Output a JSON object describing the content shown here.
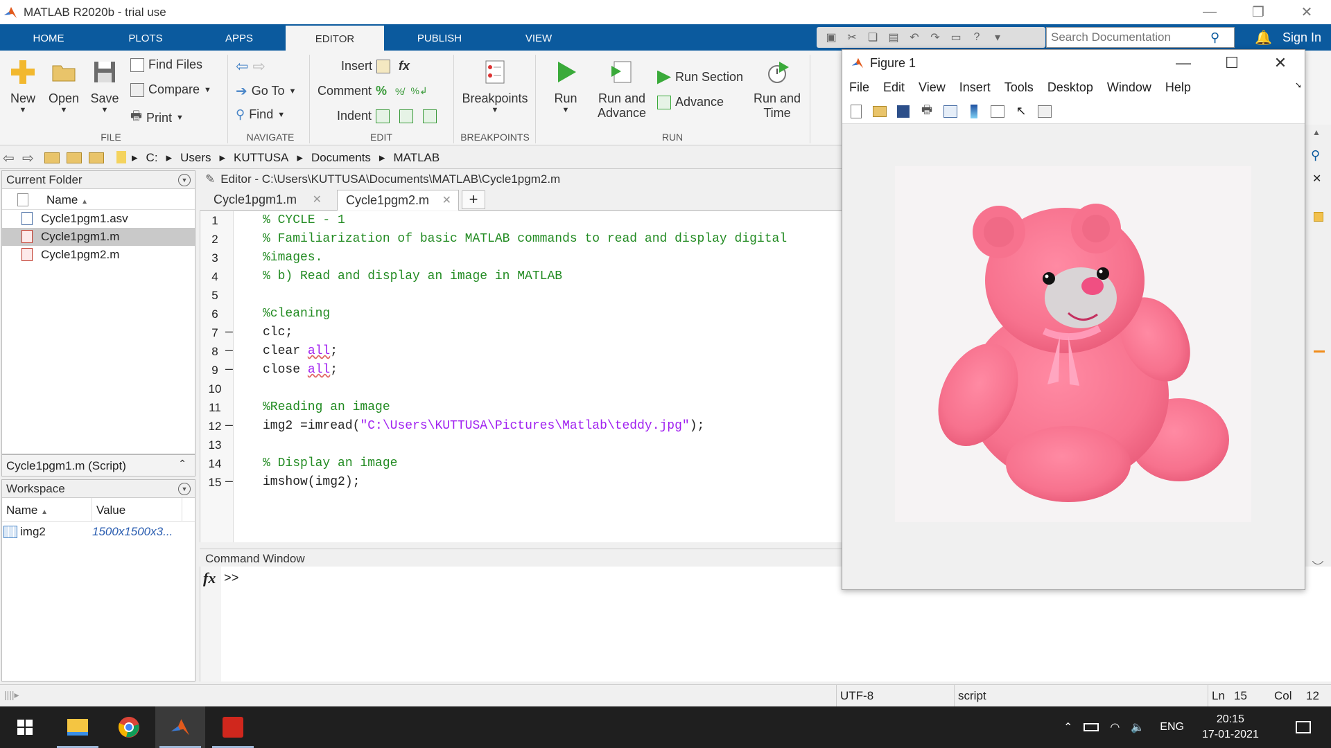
{
  "window": {
    "title": "MATLAB R2020b - trial use"
  },
  "tabs": [
    {
      "label": "HOME"
    },
    {
      "label": "PLOTS"
    },
    {
      "label": "APPS"
    },
    {
      "label": "EDITOR"
    },
    {
      "label": "PUBLISH"
    },
    {
      "label": "VIEW"
    }
  ],
  "search": {
    "placeholder": "Search Documentation"
  },
  "signin": "Sign In",
  "ribbon": {
    "file": {
      "new": "New",
      "open": "Open",
      "save": "Save",
      "find_files": "Find Files",
      "compare": "Compare",
      "print": "Print",
      "group": "FILE"
    },
    "navigate": {
      "goto": "Go To",
      "find": "Find",
      "group": "NAVIGATE"
    },
    "edit": {
      "insert": "Insert",
      "comment": "Comment",
      "indent": "Indent",
      "fx": "fx",
      "group": "EDIT"
    },
    "breakpoints": {
      "label": "Breakpoints",
      "group": "BREAKPOINTS"
    },
    "run": {
      "run": "Run",
      "run_advance_1": "Run and",
      "run_advance_2": "Advance",
      "run_section": "Run Section",
      "advance": "Advance",
      "run_time_1": "Run and",
      "run_time_2": "Time",
      "group": "RUN"
    }
  },
  "address": {
    "crumbs": [
      "C:",
      "Users",
      "KUTTUSA",
      "Documents",
      "MATLAB"
    ]
  },
  "current_folder": {
    "title": "Current Folder",
    "name_header": "Name",
    "files": [
      "Cycle1pgm1.asv",
      "Cycle1pgm1.m",
      "Cycle1pgm2.m"
    ],
    "selected": "Cycle1pgm1.m"
  },
  "details": {
    "text": "Cycle1pgm1.m  (Script)"
  },
  "workspace": {
    "title": "Workspace",
    "col_name": "Name",
    "col_value": "Value",
    "rows": [
      {
        "name": "img2",
        "value": "1500x1500x3..."
      }
    ]
  },
  "editor": {
    "header": "Editor - C:\\Users\\KUTTUSA\\Documents\\MATLAB\\Cycle1pgm2.m",
    "tabs": [
      "Cycle1pgm1.m",
      "Cycle1pgm2.m"
    ],
    "plus": "+",
    "lines": [
      {
        "n": "1",
        "text": "% CYCLE - 1"
      },
      {
        "n": "2",
        "text": "% Familiarization of basic MATLAB commands to read and display digital"
      },
      {
        "n": "3",
        "text": "%images."
      },
      {
        "n": "4",
        "text": "% b) Read and display an image in MATLAB"
      },
      {
        "n": "5",
        "text": ""
      },
      {
        "n": "6",
        "text": "%cleaning"
      },
      {
        "n": "7",
        "text": "clc;"
      },
      {
        "n": "8",
        "text": "clear",
        "kw": "all",
        "end": ";"
      },
      {
        "n": "9",
        "text": "close",
        "kw": "all",
        "end": ";"
      },
      {
        "n": "10",
        "text": ""
      },
      {
        "n": "11",
        "text": "%Reading an image"
      },
      {
        "n": "12",
        "text": "img2 =imread(",
        "str": "\"C:\\Users\\KUTTUSA\\Pictures\\Matlab\\teddy.jpg\"",
        "end": ");"
      },
      {
        "n": "13",
        "text": ""
      },
      {
        "n": "14",
        "text": "% Display an image"
      },
      {
        "n": "15",
        "text": "imshow(img2);"
      }
    ]
  },
  "command_window": {
    "title": "Command Window",
    "prompt": ">>",
    "fx": "fx"
  },
  "figure": {
    "title": "Figure 1",
    "menu": [
      "File",
      "Edit",
      "View",
      "Insert",
      "Tools",
      "Desktop",
      "Window",
      "Help"
    ]
  },
  "status": {
    "encoding": "UTF-8",
    "type": "script",
    "ln_label": "Ln",
    "ln": "15",
    "col_label": "Col",
    "col": "12"
  },
  "taskbar": {
    "lang": "ENG",
    "time": "20:15",
    "date": "17-01-2021"
  },
  "colors": {
    "ribbon_blue": "#0b5a9e",
    "comment": "#228b22",
    "string": "#a020f0",
    "teddy": "#f7728e"
  }
}
